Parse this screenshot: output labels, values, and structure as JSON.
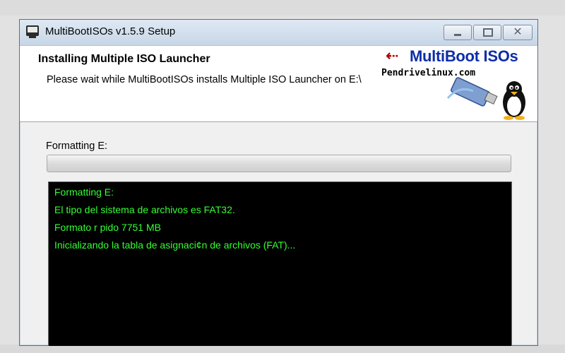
{
  "window": {
    "title": "MultiBootISOs v1.5.9 Setup",
    "buttons": {
      "minimize": "",
      "maximize": "",
      "close": "✕"
    }
  },
  "header": {
    "title": "Installing Multiple ISO Launcher",
    "subtitle": "Please wait while MultiBootISOs installs Multiple ISO Launcher on E:\\",
    "logo": {
      "title": "MultiBoot ISOs",
      "subtitle": "Pendrivelinux.com",
      "usb_icon": "usb-icon",
      "mascot_icon": "penguin-icon"
    }
  },
  "progress": {
    "label": "Formatting E:",
    "fraction": 0.0
  },
  "console": {
    "lines": [
      "Formatting E:",
      "El tipo del sistema de archivos es FAT32.",
      "Formato r pido 7751 MB",
      "Inicializando la tabla de asignaci¢n de archivos (FAT)..."
    ]
  },
  "colors": {
    "console_text": "#33ff33",
    "console_bg": "#000000",
    "logo_title": "#0d2ea8",
    "usb_red": "#b00000"
  }
}
